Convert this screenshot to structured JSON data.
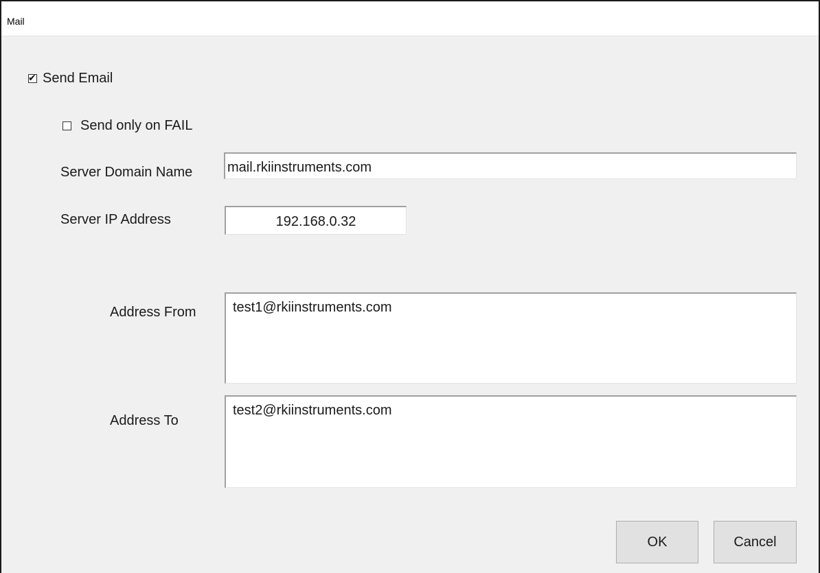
{
  "window": {
    "title": "Mail"
  },
  "send_email": {
    "label": "Send Email",
    "checked": true
  },
  "send_only_on_fail": {
    "label": "Send only on FAIL",
    "checked": false
  },
  "server_domain": {
    "label": "Server Domain Name",
    "value": "mail.rkiinstruments.com"
  },
  "server_ip": {
    "label": "Server IP Address",
    "value": "192.168.0.32"
  },
  "address_from": {
    "label": "Address From",
    "value": "test1@rkiinstruments.com"
  },
  "address_to": {
    "label": "Address To",
    "value": "test2@rkiinstruments.com"
  },
  "buttons": {
    "ok_label": "OK",
    "cancel_label": "Cancel"
  },
  "icons": {
    "check_mark": "✔"
  }
}
